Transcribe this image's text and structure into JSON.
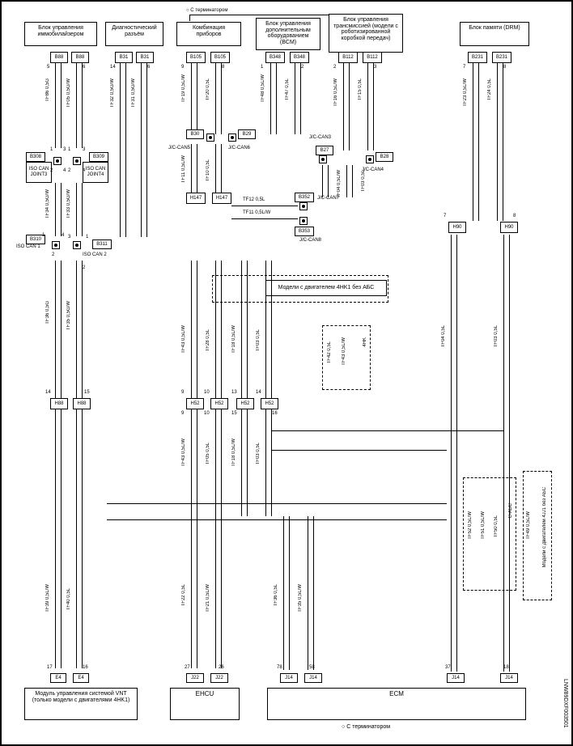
{
  "title_marker_top": "С терминатором",
  "title_marker_bottom": "С терминатором",
  "footer_id": "LNW89DXF003501",
  "header_boxes": {
    "b1": "Блок управления иммобилайзером",
    "b2": "Диагностический разъём",
    "b3": "Комбинация приборов",
    "b4": "Блок управления дополнительным оборудованием (BCM)",
    "b5": "Блок управления трансмиссией (модели с роботизированной коробкой передач)",
    "b6": "Блок памяти (DRM)"
  },
  "connectors": {
    "B88a": "B88",
    "B88b": "B88",
    "B31a": "B31",
    "B31b": "B31",
    "B105a": "B105",
    "B105b": "B105",
    "B348a": "B348",
    "B348b": "B348",
    "B112a": "B112",
    "B112b": "B112",
    "B231a": "B231",
    "B231b": "B231",
    "B308": "B308",
    "B309": "B309",
    "B30": "B30",
    "B29": "B29",
    "B27": "B27",
    "B28": "B28",
    "B352": "B352",
    "B353": "B353",
    "B310": "B310",
    "B311": "B311",
    "H88a": "H88",
    "H88b": "H88",
    "H52a": "H52",
    "H52b": "H52",
    "H52c": "H52",
    "H52d": "H52",
    "H147a": "H147",
    "H147b": "H147",
    "H90a": "H90",
    "H90b": "H90",
    "E4a": "E4",
    "E4b": "E4",
    "J22a": "J22",
    "J22b": "J22",
    "J14a": "J14",
    "J14b": "J14",
    "J14c": "J14",
    "J14d": "J14"
  },
  "joints": {
    "iso_can_joint3": "ISO CAN JOINT3",
    "iso_can_joint4": "ISO CAN JOINT4",
    "jc_can5": "J/C-CAN5",
    "jc_can6": "J/C-CAN6",
    "jc_can3": "J/C-CAN3",
    "jc_can4": "J/C-CAN4",
    "jc_can7": "J/C-CAN7",
    "jc_can8": "J/C-CAN8",
    "iso_can1": "ISO CAN 1",
    "iso_can2": "ISO CAN 2"
  },
  "modules": {
    "vnt": "Модуль управления системой VNT (только модели с двигателями 4HK1)",
    "ehcu": "EHCU",
    "ecm": "ECM"
  },
  "dashed_notes": {
    "engine_abs": "Модели с двигателем 4HK1 без АБС",
    "type_4hk": "4HK",
    "c_abs": "С-АБС",
    "engine_4jj1": "Модели с двигателем 4JJ1 без АБС"
  },
  "wire_labels": {
    "tf86": "TF86 0,5G",
    "tf05a": "TF05 0,5G/W",
    "tf32": "TF32 0,5G/W",
    "tf31": "TF31 0,5G/W",
    "tf19": "TF19 0,5L/W",
    "tf20": "TF20 0,5L",
    "tf48": "TF48 0,5L/W",
    "tf47": "TF47 0,5L",
    "tf16": "TF16 0,5L/W",
    "tf15": "TF15 0,5L",
    "tf23": "TF23 0,5L/W",
    "tf24": "TF24 0,5L",
    "tf34": "TF34 0,5G/W",
    "tf33": "TF33 0,5G/W",
    "tf11": "TF11 0,5L/W",
    "tf10": "TF10 0,5L",
    "tf04a": "TF04 0,5L/W",
    "tf03a": "TF03 0,5L",
    "tf12": "TF12 0,5L",
    "tf11b": "TF11 0,5L/W",
    "tf36": "TF36 0,5G",
    "tf35": "TF35 0,5G/W",
    "tf43a": "TF43 0,5L/W",
    "tf28": "TF28 0,5L",
    "tf18": "TF18 0,5L/W",
    "tf03b": "TF03 0,5L",
    "tf42": "TF42 0,5L",
    "tf43b": "TF43 0,5L/W",
    "tf04b": "TF04 0,5L",
    "tf03c": "TF03 0,5L",
    "tf43c": "TF43 0,5L/W",
    "tf05b": "TF05 0,5L",
    "tf18b": "TF18 0,5L/W",
    "tf03d": "TF03 0,5L",
    "tf52": "TF52 0,5L/W",
    "tf51": "TF51 0,5L/W",
    "tf50": "TF50 0,5L",
    "tf49": "TF49 0,5L/W",
    "tf39": "TF39 0,5L/W",
    "tf40": "TF40 0,5L",
    "tf22": "TF22 0,5L",
    "tf21": "TF21 0,5L/W",
    "tf36b": "TF36 0,5L",
    "tf35b": "TF35 0,5L/W"
  },
  "pin_numbers": {
    "p1": "1",
    "p2": "2",
    "p3": "3",
    "p4": "4",
    "p5": "5",
    "p6": "6",
    "p7": "7",
    "p8": "8",
    "p9": "9",
    "p10": "10",
    "p13": "13",
    "p14": "14",
    "p15": "15",
    "p16": "16",
    "p17": "17",
    "p18": "18",
    "p26": "26",
    "p27": "27",
    "p37": "37",
    "p58": "58",
    "p78": "78"
  }
}
